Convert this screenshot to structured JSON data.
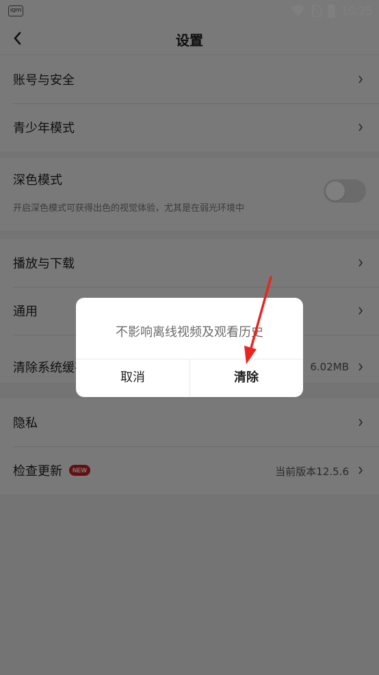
{
  "status_bar": {
    "app_badge": "iQIYI",
    "time": "10:25",
    "icons": [
      "wifi-icon",
      "no-sim-icon",
      "battery-icon"
    ]
  },
  "header": {
    "title": "设置",
    "back_icon": "chevron-left-icon"
  },
  "settings": {
    "account_security": "账号与安全",
    "teen_mode": "青少年模式",
    "dark_mode": {
      "label": "深色模式",
      "description": "开启深色模式可获得出色的视觉体验，尤其是在弱光环境中",
      "enabled": false
    },
    "playback_download": "播放与下载",
    "general": "通用",
    "clear_cache": {
      "label": "清除系统缓存",
      "value": "6.02MB"
    },
    "privacy": "隐私",
    "check_update": {
      "label": "检查更新",
      "badge": "NEW",
      "value": "当前版本12.5.6"
    }
  },
  "dialog": {
    "message": "不影响离线视频及观看历史",
    "cancel_label": "取消",
    "confirm_label": "清除"
  },
  "colors": {
    "badge_red": "#c8211e",
    "annotation_red": "#e8261f",
    "overlay": "rgba(0,0,0,0.5)"
  }
}
